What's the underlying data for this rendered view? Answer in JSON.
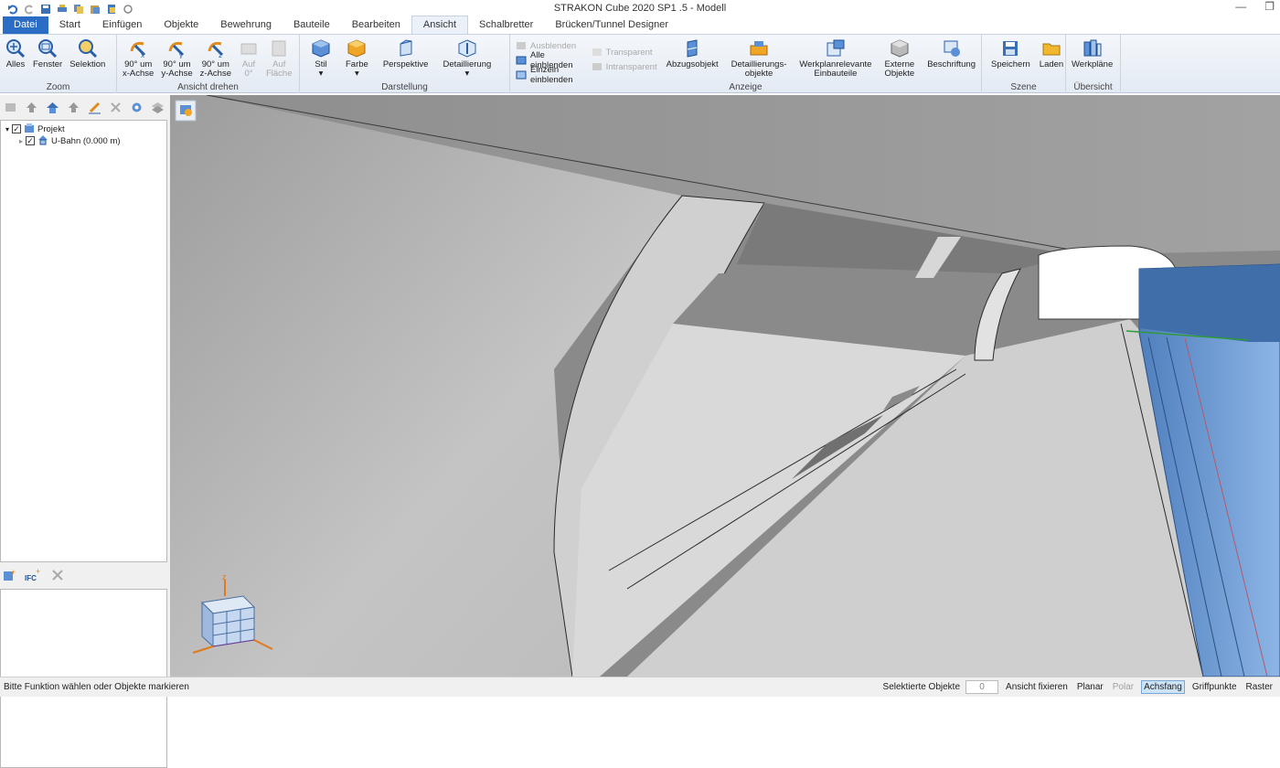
{
  "window": {
    "title": "STRAKON Cube 2020 SP1 .5 - Modell"
  },
  "tabs": [
    {
      "label": "Datei"
    },
    {
      "label": "Start"
    },
    {
      "label": "Einfügen"
    },
    {
      "label": "Objekte"
    },
    {
      "label": "Bewehrung"
    },
    {
      "label": "Bauteile"
    },
    {
      "label": "Bearbeiten"
    },
    {
      "label": "Ansicht"
    },
    {
      "label": "Schalbretter"
    },
    {
      "label": "Brücken/Tunnel Designer"
    }
  ],
  "ribbon": {
    "zoom": {
      "label": "Zoom",
      "alles": "Alles",
      "fenster": "Fenster",
      "selektion": "Selektion"
    },
    "drehen": {
      "label": "Ansicht drehen",
      "x1": "90° um",
      "x2": "x-Achse",
      "y1": "90° um",
      "y2": "y-Achse",
      "z1": "90° um",
      "z2": "z-Achse",
      "auf1": "Auf",
      "auf2": "0°",
      "fl1": "Auf",
      "fl2": "Fläche"
    },
    "darstellung": {
      "label": "Darstellung",
      "stil": "Stil",
      "farbe": "Farbe",
      "perspektive": "Perspektive",
      "detaillierung": "Detaillierung"
    },
    "anzeige": {
      "label": "Anzeige",
      "ausblenden": "Ausblenden",
      "alle_einblenden": "Alle einblenden",
      "einzeln_einblenden": "Einzeln einblenden",
      "transparent": "Transparent",
      "intransparent": "Intransparent",
      "abzugsobjekt": "Abzugsobjekt",
      "detail1": "Detaillierungs-",
      "detail2": "objekte",
      "werk1": "Werkplanrelevante",
      "werk2": "Einbauteile",
      "ext1": "Externe",
      "ext2": "Objekte",
      "beschriftung": "Beschriftung"
    },
    "szene": {
      "label": "Szene",
      "speichern": "Speichern",
      "laden": "Laden"
    },
    "uebersicht": {
      "label": "Übersicht",
      "werkplaene": "Werkpläne"
    }
  },
  "tree": {
    "root": "Projekt",
    "child": "U-Bahn (0.000 m)"
  },
  "status": {
    "message": "Bitte Funktion wählen oder Objekte markieren",
    "selected_label": "Selektierte Objekte",
    "selected_count": "0",
    "fix": "Ansicht fixieren",
    "planar": "Planar",
    "polar": "Polar",
    "achsfang": "Achsfang",
    "griffpunkte": "Griffpunkte",
    "raster": "Raster"
  },
  "colors": {
    "accent": "#2b6cc4",
    "ribbon_bg": "#e3eaf3",
    "object_blue": "#6f9fd8"
  }
}
